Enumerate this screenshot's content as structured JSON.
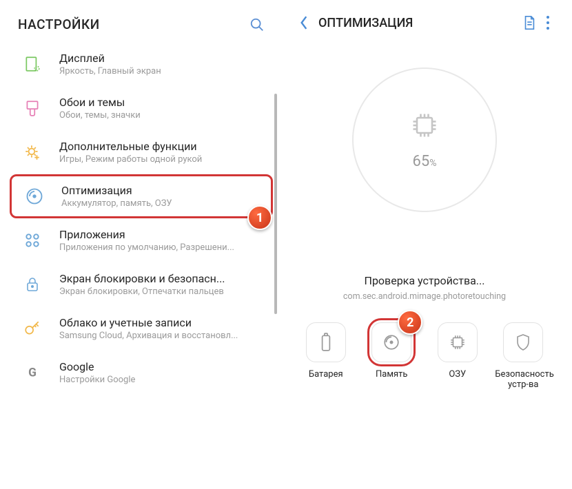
{
  "left": {
    "header_title": "НАСТРОЙКИ",
    "items": [
      {
        "title": "Дисплей",
        "subtitle": "Яркость, Главный экран"
      },
      {
        "title": "Обои и темы",
        "subtitle": "Обои, темы, значки"
      },
      {
        "title": "Дополнительные функции",
        "subtitle": "Игры, Режим работы одной рукой"
      },
      {
        "title": "Оптимизация",
        "subtitle": "Аккумулятор, память, ОЗУ"
      },
      {
        "title": "Приложения",
        "subtitle": "Приложения по умолчанию, Разрешени..."
      },
      {
        "title": "Экран блокировки и безопасн...",
        "subtitle": "Экран блокировки, Отпечатки пальцев"
      },
      {
        "title": "Облако и учетные записи",
        "subtitle": "Samsung Cloud, Архивация и восстановл..."
      },
      {
        "title": "Google",
        "subtitle": "Настройки Google"
      }
    ]
  },
  "right": {
    "header_title": "ОПТИМИЗАЦИЯ",
    "percent_value": "65",
    "percent_sign": "%",
    "status_title": "Проверка устройства...",
    "status_sub": "com.sec.android.mimage.photoretouching",
    "tiles": [
      {
        "label": "Батарея"
      },
      {
        "label": "Память"
      },
      {
        "label": "ОЗУ"
      },
      {
        "label": "Безопасность устр-ва"
      }
    ]
  },
  "badges": {
    "one": "1",
    "two": "2"
  }
}
